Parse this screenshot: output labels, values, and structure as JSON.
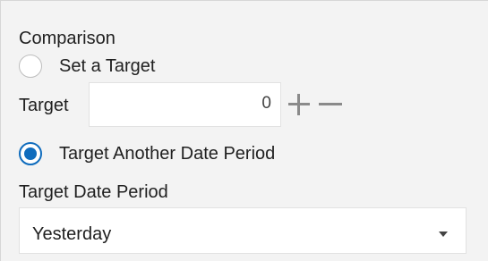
{
  "comparison": {
    "heading": "Comparison",
    "options": {
      "set_target": {
        "label": "Set a Target",
        "selected": false
      },
      "target_another_date_period": {
        "label": "Target Another Date Period",
        "selected": true
      }
    },
    "target": {
      "label": "Target",
      "value": "0"
    },
    "target_date_period": {
      "label": "Target Date Period",
      "selected": "Yesterday"
    }
  },
  "icons": {
    "increment": "plus-icon",
    "decrement": "minus-icon",
    "dropdown": "chevron-down-icon"
  },
  "colors": {
    "panel_background": "#f3f3f3",
    "radio_selected": "#0f6cbd"
  }
}
